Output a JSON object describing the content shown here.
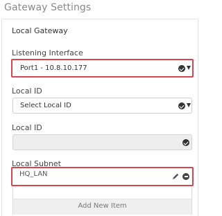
{
  "page": {
    "title": "Gateway Settings"
  },
  "local_gateway": {
    "section_title": "Local Gateway",
    "listening_interface": {
      "label": "Listening Interface",
      "value": "Port1 - 10.8.10.177"
    },
    "local_id_type": {
      "label": "Local ID",
      "value": "Select Local ID"
    },
    "local_id_value": {
      "label": "Local ID",
      "value": ""
    },
    "local_subnet": {
      "label": "Local Subnet",
      "items": [
        "HQ_LAN"
      ],
      "add_label": "Add New Item"
    }
  },
  "icons": {
    "dropdown_check": "check-circle-icon",
    "dropdown_caret": "caret-down-icon",
    "edit": "pencil-icon",
    "remove": "minus-circle-icon"
  },
  "colors": {
    "highlight_border": "#d64550",
    "disabled_field": "#eeeeee"
  }
}
